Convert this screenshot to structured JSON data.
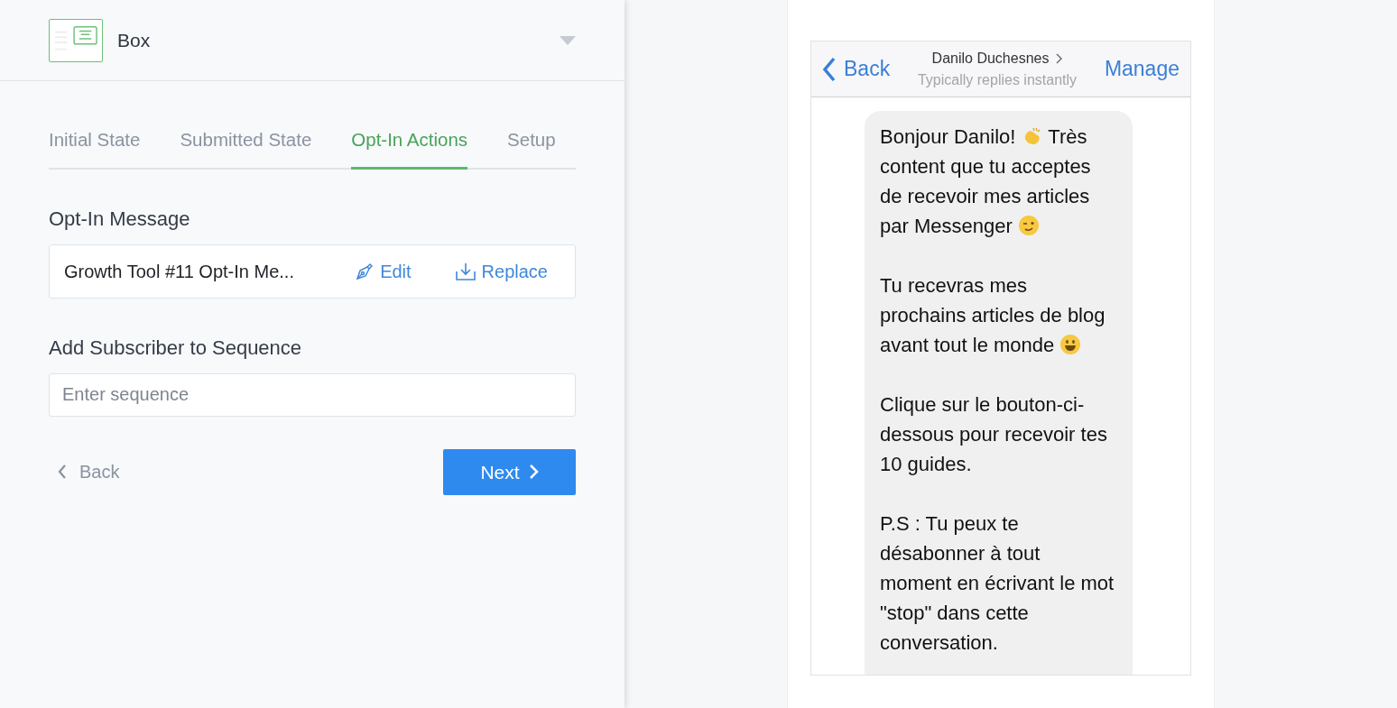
{
  "widget": {
    "title": "Box"
  },
  "tabs": [
    {
      "label": "Initial State",
      "selected": false
    },
    {
      "label": "Submitted State",
      "selected": false
    },
    {
      "label": "Opt-In Actions",
      "selected": true
    },
    {
      "label": "Setup",
      "selected": false
    }
  ],
  "opt_in_message": {
    "heading": "Opt-In Message",
    "value": "Growth Tool #11 Opt-In Me...",
    "edit": "Edit",
    "replace": "Replace"
  },
  "sequence": {
    "heading": "Add Subscriber to Sequence",
    "placeholder": "Enter sequence"
  },
  "footer": {
    "back": "Back",
    "next": "Next"
  },
  "preview": {
    "back": "Back",
    "contact": "Danilo Duchesnes",
    "status": "Typically replies instantly",
    "manage": "Manage",
    "paragraphs": [
      {
        "parts": [
          {
            "kind": "text",
            "text": "Bonjour Danilo! "
          },
          {
            "kind": "clap"
          },
          {
            "kind": "text",
            "text": " Très content que tu acceptes de recevoir mes articles par Messenger "
          },
          {
            "kind": "wink"
          }
        ]
      },
      {
        "parts": [
          {
            "kind": "text",
            "text": "Tu recevras mes prochains articles de blog avant tout le monde "
          },
          {
            "kind": "grin"
          }
        ]
      },
      {
        "parts": [
          {
            "kind": "text",
            "text": "Clique sur le bouton-ci-dessous pour recevoir tes 10 guides."
          }
        ]
      },
      {
        "parts": [
          {
            "kind": "text",
            "text": "P.S : Tu peux te désabonner à tout moment en écrivant le mot \"stop\" dans cette conversation."
          }
        ]
      }
    ]
  }
}
